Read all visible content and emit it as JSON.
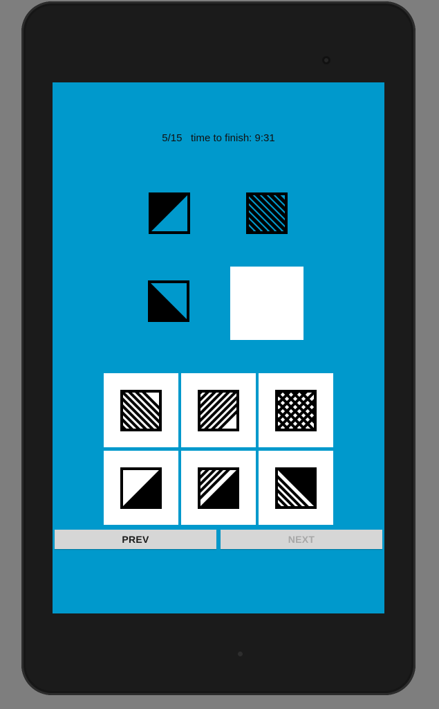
{
  "test": {
    "progress": "5/15",
    "time_label": "time to finish: 9:31",
    "status_text": "5/15   time to finish: 9:31"
  },
  "matrix": {
    "cells": [
      "half-black-upper-left-icon",
      "diagonal-hatch-icon",
      "half-black-lower-left-icon",
      "empty-answer-slot"
    ]
  },
  "options": [
    {
      "icon": "diagonal-hatch-down-icon"
    },
    {
      "icon": "diagonal-hatch-up-icon"
    },
    {
      "icon": "crosshatch-icon"
    },
    {
      "icon": "half-black-lower-right-icon"
    },
    {
      "icon": "partial-hatch-up-icon"
    },
    {
      "icon": "partial-hatch-down-icon"
    }
  ],
  "nav": {
    "prev_label": "PREV",
    "next_label": "NEXT"
  },
  "colors": {
    "screen_bg": "#0099cc",
    "tile_bg": "#ffffff",
    "button_bg": "#d6d6d6",
    "next_disabled_text": "#a7a7a7"
  }
}
